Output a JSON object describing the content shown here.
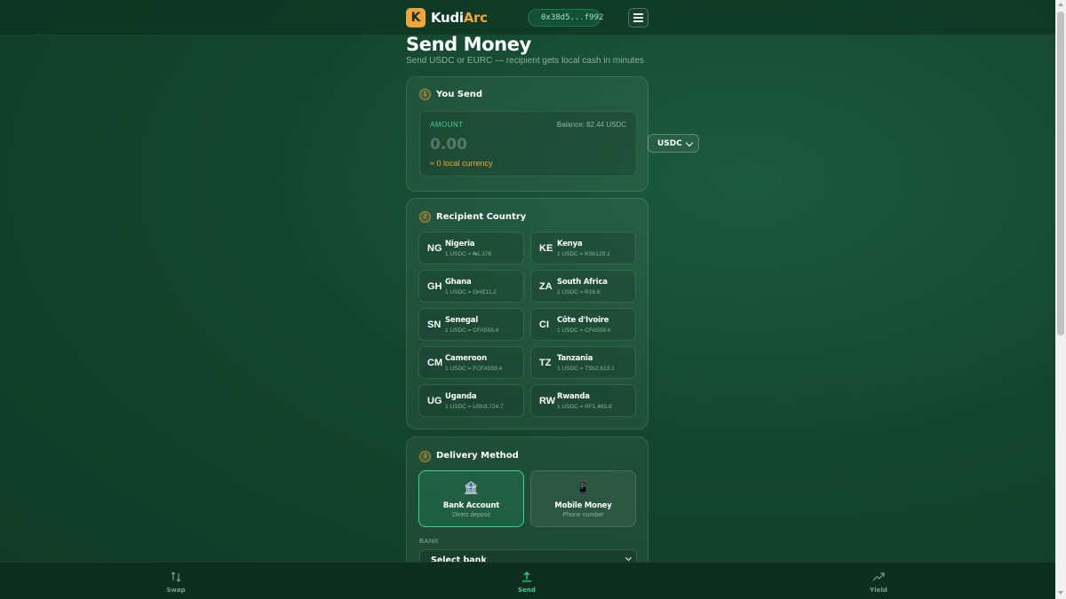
{
  "header": {
    "logo_letter": "K",
    "brand_part1": "Kudi",
    "brand_part2": "Arc",
    "wallet_address": "0x38d5...f992",
    "menu_icon": "hamburger-icon"
  },
  "page": {
    "title": "Send Money",
    "subtitle": "Send USDC or EURC — recipient gets local cash in minutes"
  },
  "send_card": {
    "step": "1",
    "title": "You Send",
    "amount_label": "AMOUNT",
    "balance": "Balance: 82.44 USDC",
    "amount_placeholder": "0.00",
    "local_estimate": "≈ 0 local currency",
    "currency": "USDC"
  },
  "country_card": {
    "step": "2",
    "title": "Recipient Country",
    "countries": [
      {
        "code": "NG",
        "name": "Nigeria",
        "rate": "1 USDC = ₦1,376"
      },
      {
        "code": "KE",
        "name": "Kenya",
        "rate": "1 USDC = KSh129.1"
      },
      {
        "code": "GH",
        "name": "Ghana",
        "rate": "1 USDC = GH₵11.2"
      },
      {
        "code": "ZA",
        "name": "South Africa",
        "rate": "1 USDC = R16.6"
      },
      {
        "code": "SN",
        "name": "Senegal",
        "rate": "1 USDC = CFA559.4"
      },
      {
        "code": "CI",
        "name": "Côte d'Ivoire",
        "rate": "1 USDC = CFA559.4"
      },
      {
        "code": "CM",
        "name": "Cameroon",
        "rate": "1 USDC = FCFA559.4"
      },
      {
        "code": "TZ",
        "name": "Tanzania",
        "rate": "1 USDC = TSh2,613.1"
      },
      {
        "code": "UG",
        "name": "Uganda",
        "rate": "1 USDC = USh3,724.7"
      },
      {
        "code": "RW",
        "name": "Rwanda",
        "rate": "1 USDC = RF1,463.8"
      }
    ]
  },
  "delivery_card": {
    "step": "3",
    "title": "Delivery Method",
    "methods": [
      {
        "title": "Bank Account",
        "subtitle": "Direct deposit",
        "icon": "bank-icon",
        "glyph": "🏦",
        "selected": true
      },
      {
        "title": "Mobile Money",
        "subtitle": "Phone number",
        "icon": "phone-icon",
        "glyph": "📱",
        "selected": false
      }
    ],
    "bank_label": "BANK",
    "bank_placeholder": "Select bank"
  },
  "bottom_nav": {
    "items": [
      {
        "label": "Swap",
        "icon": "swap-icon",
        "active": false
      },
      {
        "label": "Send",
        "icon": "send-icon",
        "active": true
      },
      {
        "label": "Yield",
        "icon": "trending-up-icon",
        "active": false
      }
    ]
  },
  "colors": {
    "accent_orange": "#f0a53a",
    "accent_green": "#3fd28a",
    "background": "#14462f"
  }
}
